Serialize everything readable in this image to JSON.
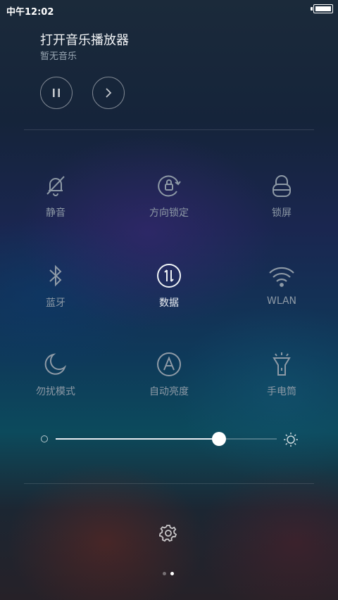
{
  "status_bar": {
    "time": "中午12:02",
    "battery_level": 1.0
  },
  "music": {
    "title": "打开音乐播放器",
    "subtitle": "暂无音乐"
  },
  "tiles": [
    {
      "label": "静音",
      "icon": "bell-off-icon",
      "active": false
    },
    {
      "label": "方向锁定",
      "icon": "rotation-lock-icon",
      "active": false
    },
    {
      "label": "锁屏",
      "icon": "lock-icon",
      "active": false
    },
    {
      "label": "蓝牙",
      "icon": "bluetooth-icon",
      "active": false
    },
    {
      "label": "数据",
      "icon": "mobile-data-icon",
      "active": true
    },
    {
      "label": "WLAN",
      "icon": "wifi-icon",
      "active": false
    },
    {
      "label": "勿扰模式",
      "icon": "moon-icon",
      "active": false
    },
    {
      "label": "自动亮度",
      "icon": "auto-brightness-icon",
      "active": false
    },
    {
      "label": "手电筒",
      "icon": "flashlight-icon",
      "active": false
    }
  ],
  "brightness": {
    "level": 0.74
  },
  "pager": {
    "pages": 2,
    "current": 2
  },
  "colors": {
    "active": "#eef2f5",
    "inactive": "#8e9aa6"
  }
}
